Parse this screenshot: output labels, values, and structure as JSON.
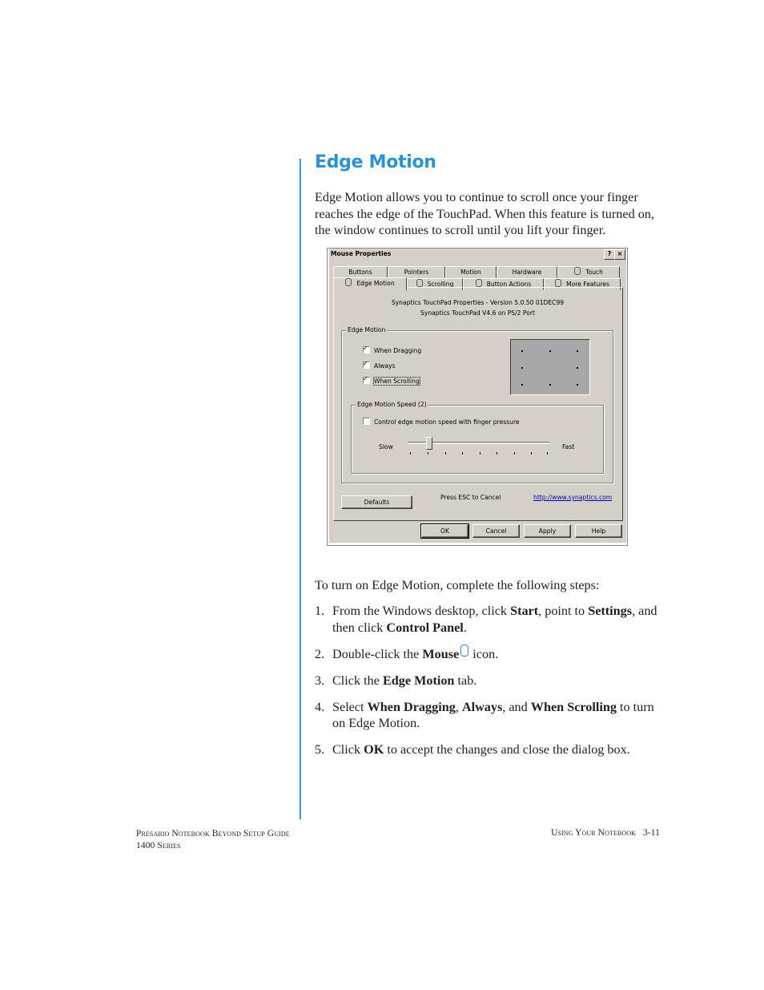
{
  "section": {
    "title": "Edge Motion",
    "intro": "Edge Motion allows you to continue to scroll once your finger reaches the edge of the TouchPad. When this feature is turned on, the window continues to scroll until you lift your finger.",
    "lead": "To turn on Edge Motion, complete the following steps:"
  },
  "steps": [
    {
      "num": "1.",
      "parts": [
        "From the Windows desktop, click ",
        "Start",
        ", point to ",
        "Settings",
        ", and then click ",
        "Control Panel",
        "."
      ]
    },
    {
      "num": "2.",
      "parts": [
        "Double-click the ",
        "Mouse",
        " icon."
      ]
    },
    {
      "num": "3.",
      "parts": [
        "Click the ",
        "Edge Motion",
        " tab."
      ]
    },
    {
      "num": "4.",
      "parts": [
        "Select ",
        "When Dragging",
        ", ",
        "Always",
        ", and ",
        "When Scrolling",
        " to turn on Edge Motion."
      ]
    },
    {
      "num": "5.",
      "parts": [
        "Click ",
        "OK",
        " to accept the changes and close the dialog box."
      ]
    }
  ],
  "dialog": {
    "title": "Mouse Properties",
    "help_btn": "?",
    "close_btn": "×",
    "tabs_row1": [
      "Buttons",
      "Pointers",
      "Motion",
      "Hardware",
      "Touch"
    ],
    "tabs_row2": [
      "Edge Motion",
      "Scrolling",
      "Button Actions",
      "More Features"
    ],
    "info_line1": "Synaptics TouchPad Properties - Version 5.0.50 01DEC99",
    "info_line2": "Synaptics TouchPad V4.6 on PS/2 Port",
    "group_label": "Edge Motion",
    "checkboxes": [
      {
        "label": "When Dragging",
        "checked": true
      },
      {
        "label": "Always",
        "checked": true
      },
      {
        "label": "When Scrolling",
        "checked": true
      }
    ],
    "speed_group_label": "Edge Motion Speed (2)",
    "pressure_checkbox": {
      "label": "Control edge motion speed with finger pressure",
      "checked": false
    },
    "slider": {
      "min_label": "Slow",
      "max_label": "Fast",
      "level": 2
    },
    "defaults_btn": "Defaults",
    "esc_hint": "Press ESC to Cancel",
    "link": "http://www.synaptics.com",
    "buttons": [
      "OK",
      "Cancel",
      "Apply",
      "Help"
    ]
  },
  "footer": {
    "left_line1": "Presario Notebook Beyond Setup Guide",
    "left_line2": "1400 Series",
    "right": "Using Your Notebook",
    "page": "3-11"
  },
  "colors": {
    "accent": "#2a92d6",
    "dialog_face": "#d4d0c8"
  }
}
